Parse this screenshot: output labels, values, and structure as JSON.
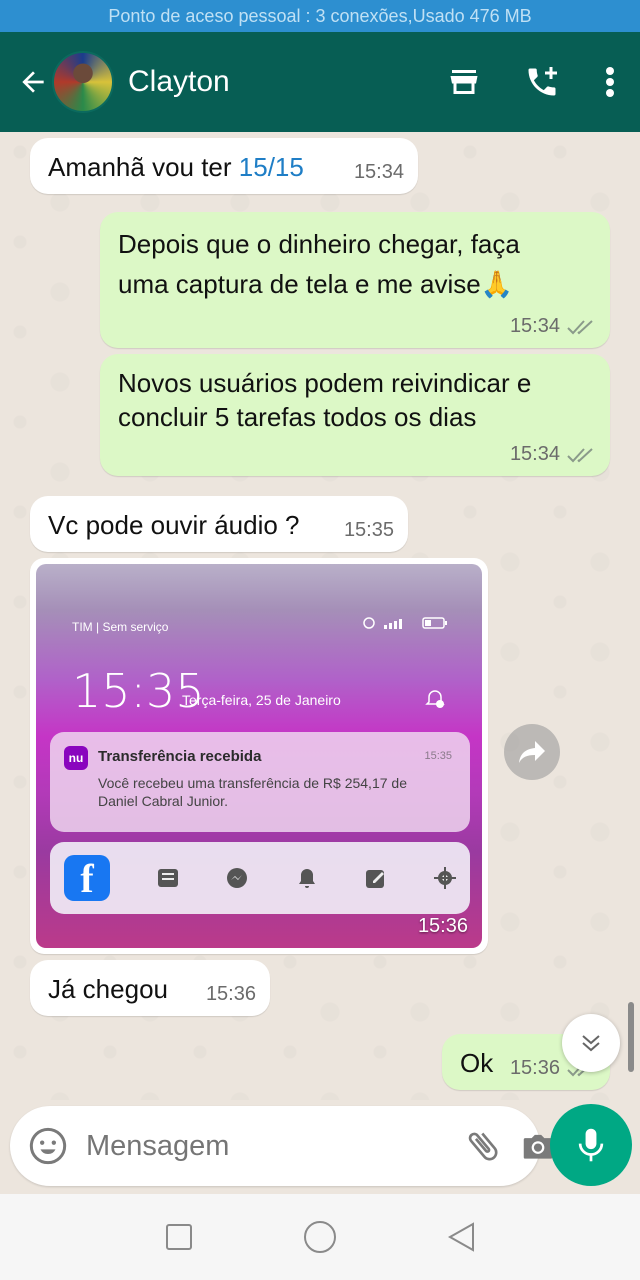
{
  "status_bar": {
    "text": "Ponto de aceso pessoal : 3 conexões,Usado 476 MB"
  },
  "header": {
    "contact_name": "Clayton"
  },
  "messages": [
    {
      "dir": "in",
      "text": "Amanhã vou ter ",
      "link": "15/15",
      "time": "15:34"
    },
    {
      "dir": "out",
      "text": "Depois que o dinheiro chegar, faça uma captura de tela e me avise",
      "emoji": "🙏",
      "time": "15:34"
    },
    {
      "dir": "out",
      "text": "Novos usuários podem reivindicar e concluir 5 tarefas todos os dias",
      "time": "15:34"
    },
    {
      "dir": "in",
      "text": "Vc pode ouvir áudio ?",
      "time": "15:35"
    },
    {
      "dir": "in",
      "text": "Já chegou",
      "time": "15:36"
    },
    {
      "dir": "out",
      "text": "Ok",
      "time": "15:36"
    }
  ],
  "media": {
    "time": "15:36",
    "screenshot": {
      "carrier": "TIM | Sem serviço",
      "clock": "15:35",
      "date": "Terça-feira, 25 de Janeiro",
      "notification": {
        "app_icon": "nu",
        "title": "Transferência recebida",
        "time": "15:35",
        "body": "Você recebeu uma transferência de R$ 254,17 de Daniel Cabral Junior."
      }
    }
  },
  "input": {
    "placeholder": "Mensagem"
  },
  "colors": {
    "header": "#075e54",
    "outgoing": "#dcf8c6",
    "incoming": "#ffffff",
    "mic": "#00a884",
    "status_bar": "#2d8fd0"
  }
}
